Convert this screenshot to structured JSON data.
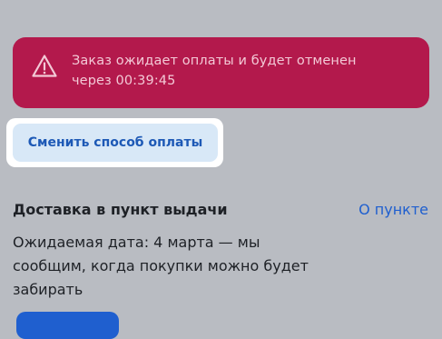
{
  "alert": {
    "icon": "warning-triangle-icon",
    "line1": "Заказ ожидает оплаты и будет отменен",
    "line2": "через 00:39:45",
    "background": "#b3194c"
  },
  "payment": {
    "change_label": "Сменить способ оплаты"
  },
  "delivery": {
    "title": "Доставка в пункт выдачи",
    "about_link": "О пункте",
    "description_lines": [
      "Ожидаемая дата: 4 марта — мы",
      "сообщим, когда покупки можно будет",
      "забирать"
    ]
  },
  "colors": {
    "accent": "#1f5fcf",
    "background": "#b9bcc2"
  }
}
